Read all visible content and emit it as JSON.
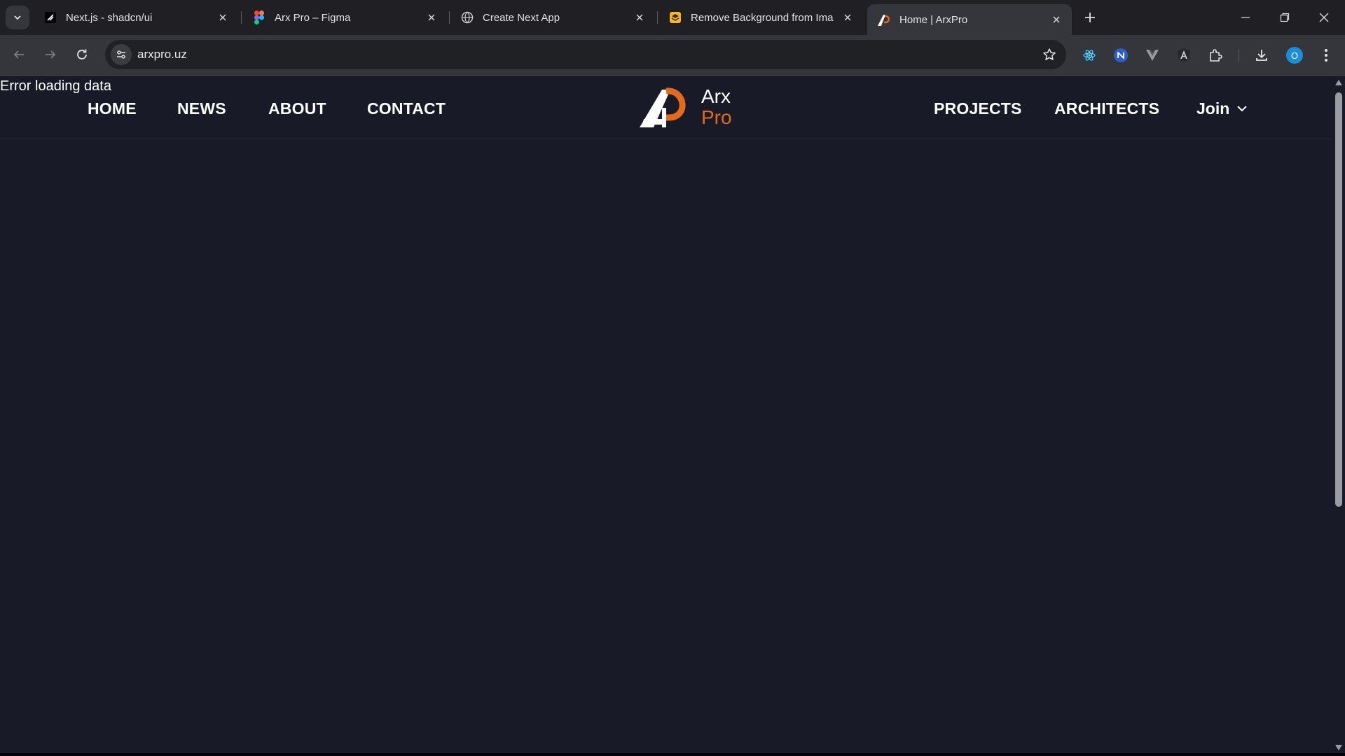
{
  "browser": {
    "tabs": [
      {
        "title": "Next.js - shadcn/ui",
        "icon": "shadcn-icon",
        "active": false
      },
      {
        "title": "Arx Pro – Figma",
        "icon": "figma-icon",
        "active": false
      },
      {
        "title": "Create Next App",
        "icon": "globe-icon",
        "active": false
      },
      {
        "title": "Remove Background from Imag",
        "icon": "remove-bg-icon",
        "active": false
      },
      {
        "title": "Home | ArxPro",
        "icon": "arxpro-icon",
        "active": true
      }
    ],
    "url": "arxpro.uz",
    "profile_initial": "O",
    "extensions": [
      "react-devtools-icon",
      "n-extension-icon",
      "vue-devtools-icon",
      "angular-icon",
      "puzzle-icon"
    ]
  },
  "page": {
    "error_message": "Error loading data",
    "nav_left": [
      "HOME",
      "NEWS",
      "ABOUT",
      "CONTACT"
    ],
    "nav_right": [
      "PROJECTS",
      "ARCHITECTS"
    ],
    "join_label": "Join",
    "logo": {
      "line1": "Arx",
      "line2": "Pro"
    }
  },
  "colors": {
    "page_background": "#181a28",
    "brand_orange": "#e26a1e",
    "text": "#ffffff"
  }
}
